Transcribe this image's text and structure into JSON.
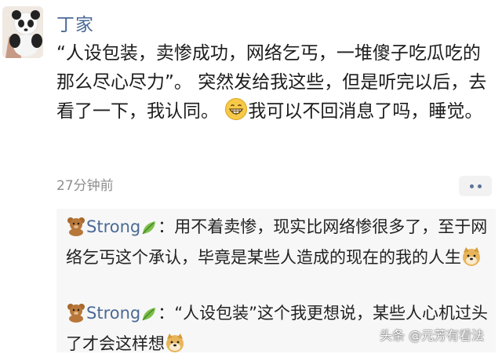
{
  "post": {
    "author": "丁家",
    "body_part1": "“人设包装，卖惨成功，网络乞丐，一堆傻子吃瓜吃的那么尽心尽力”。 突然发给我这些，但是听完以后，去看了一下，我认同。",
    "body_part2": "我可以不回消息了吗，睡觉。",
    "emoji": "grin-face-icon",
    "timestamp": "27分钟前"
  },
  "comments": [
    {
      "username": "Strong",
      "separator": "：",
      "text": "用不着卖惨，现实比网络惨很多了，至于网络乞丐这个承认，毕竟是某些人造成的现在的我的人生"
    },
    {
      "username": "Strong",
      "separator": "：",
      "text": "“人设包装”这个我更想说，某些人心机过头了才会这样想"
    }
  ],
  "watermark": "头条 @元芳有看法",
  "colors": {
    "username": "#4b6a96",
    "timestamp": "#8e8e8e",
    "comment_bg": "#f7f7f7"
  }
}
